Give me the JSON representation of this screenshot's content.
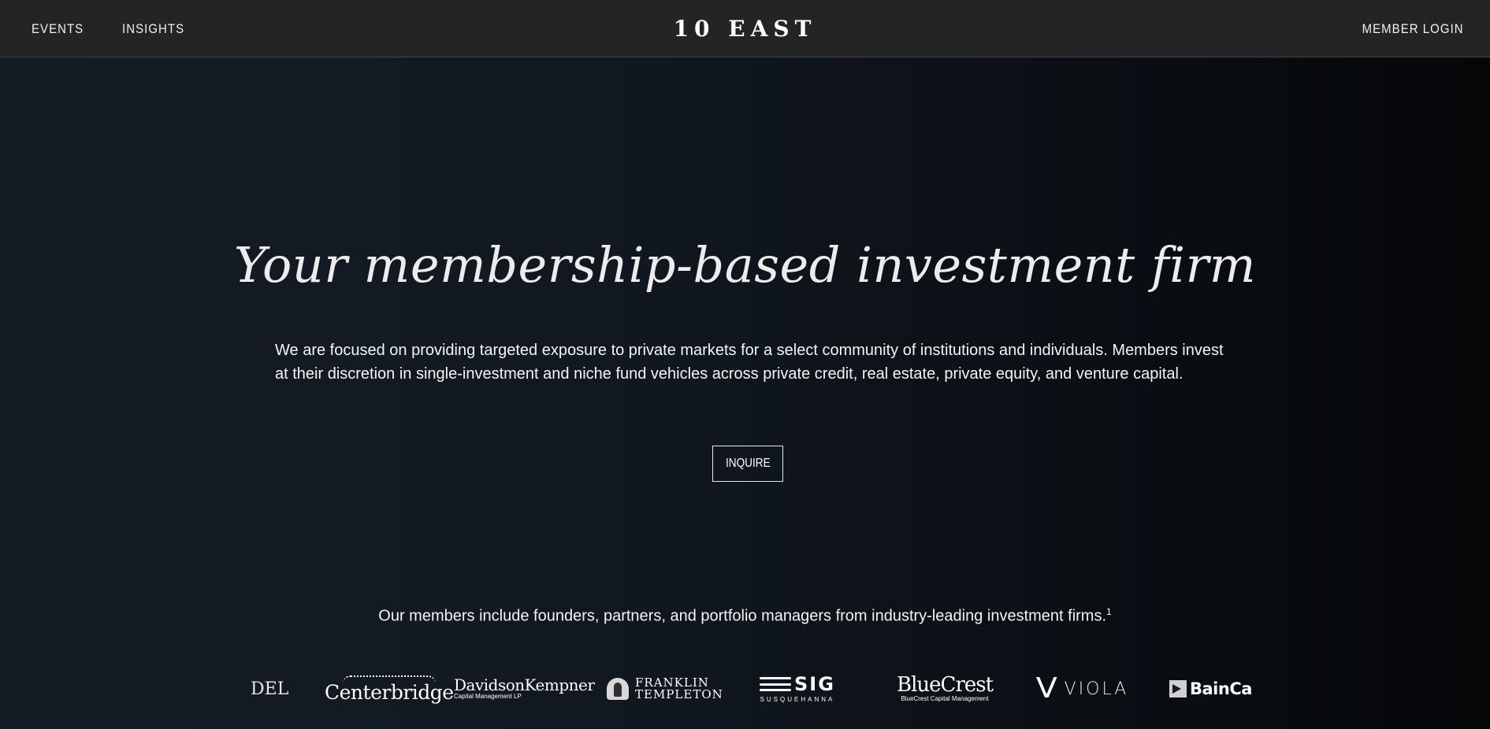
{
  "nav": {
    "events_label": "EVENTS",
    "insights_label": "INSIGHTS",
    "brand": "10 EAST",
    "member_login_label": "MEMBER LOGIN"
  },
  "hero": {
    "title": "Your membership-based investment firm",
    "description": "We are focused on providing targeted exposure to private markets for a select community of institutions and individuals. Members invest at their discretion in single-investment and niche fund vehicles across private credit, real estate, private equity, and venture capital.",
    "inquire_label": "INQUIRE"
  },
  "members": {
    "text": "Our members include founders, partners, and portfolio managers from industry-leading investment firms.",
    "footnote": "1"
  },
  "logos": {
    "del": "DEL",
    "centerbridge": "Centerbridge",
    "davidson_kempner": "DavidsonKempner",
    "davidson_kempner_sub": "Capital Management LP",
    "franklin_line1": "FRANKLIN",
    "franklin_line2": "TEMPLETON",
    "sig": "SIG",
    "sig_sub": "SUSQUEHANNA",
    "bluecrest": "BlueCrest",
    "bluecrest_sub": "BlueCrest Capital Management",
    "viola_mark": "V",
    "viola": "VIOLA",
    "bain": "BainCa"
  },
  "colors": {
    "topbar": "#242424",
    "background_left": "#151c24",
    "background_right": "#050608",
    "text": "#ffffff"
  }
}
